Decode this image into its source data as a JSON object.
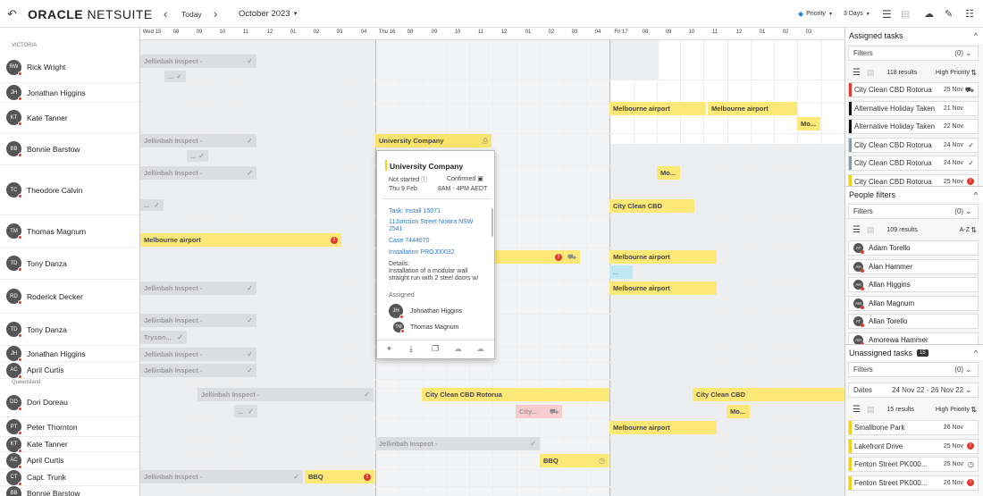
{
  "topbar": {
    "back_icon": "back-arrow-icon",
    "logo_oracle": "ORACLE",
    "logo_netsuite": "NETSUITE",
    "prev_label": "‹",
    "today_label": "Today",
    "next_label": "›",
    "month_label": "October 2023",
    "priority_label": "Priority",
    "days_label": "3 Days"
  },
  "sidebar": {
    "groups": [
      {
        "name": "VICTORIA"
      },
      {
        "name": "Queensland"
      }
    ],
    "resources": [
      {
        "initials": "RW",
        "name": "Rick Wright"
      },
      {
        "initials": "JH",
        "name": "Jonathan Higgins"
      },
      {
        "initials": "KT",
        "name": "Kate Tanner"
      },
      {
        "initials": "BB",
        "name": "Bonnie Barstow"
      },
      {
        "initials": "TC",
        "name": "Theodore Calvin"
      },
      {
        "initials": "TM",
        "name": "Thomas Magnum"
      },
      {
        "initials": "TD",
        "name": "Tony Danza"
      },
      {
        "initials": "RD",
        "name": "Roderick Decker"
      },
      {
        "initials": "TD",
        "name": "Tony Danza"
      },
      {
        "initials": "JH",
        "name": "Jonathan Higgins"
      },
      {
        "initials": "AC",
        "name": "April Curtis"
      },
      {
        "initials": "DD",
        "name": "Dori Doreau"
      },
      {
        "initials": "PT",
        "name": "Peter Thornton"
      },
      {
        "initials": "KT",
        "name": "Kate Tanner"
      },
      {
        "initials": "AC",
        "name": "April Curtis"
      },
      {
        "initials": "CT",
        "name": "Capt. Trunk"
      },
      {
        "initials": "BB",
        "name": "Bonnie Barstow"
      }
    ]
  },
  "timeline": {
    "days": [
      {
        "label": "Wed 15",
        "ticks": [
          "08",
          "09",
          "10",
          "11",
          "12",
          "01",
          "02",
          "03",
          "04"
        ]
      },
      {
        "label": "Thu 16",
        "ticks": [
          "08",
          "09",
          "10",
          "11",
          "12",
          "01",
          "02",
          "03",
          "04"
        ]
      },
      {
        "label": "Fri 17",
        "ticks": [
          "08",
          "09",
          "10",
          "11",
          "12",
          "01",
          "02",
          "03"
        ]
      }
    ],
    "tasks": {
      "t1": "Jellinbah Inspect -",
      "t2": "...",
      "t3": "Melbourne airport",
      "t4": "Melbourne airport",
      "t5": "Mo...",
      "t6": "Jellinbah Inspect -",
      "t7": "University Company",
      "t8": "...",
      "t9": "Jellinbah Inspect -",
      "t10": "Mo...",
      "t11": "...",
      "t12": "City Clean CBD",
      "t13": "Melbourne airport",
      "t14": "Melbourne airport",
      "t15": "...",
      "t16": "Jellinbah Inspect -",
      "t17": "Melbourne airport",
      "t18": "Jellinbah Inspect -",
      "t19": "Tryson...",
      "t20": "Jellinbah Inspect -",
      "t21": "Jellinbah Inspect -",
      "t22": "Jellinbah Inspect -",
      "t23": "City Clean CBD Rotorua",
      "t24": "City Clean CBD",
      "t25": "...",
      "t26": "City...",
      "t27": "Mo...",
      "t28": "Melbourne airport",
      "t29": "Jellinbah Inspect -",
      "t30": "BBQ",
      "t31": "Jellinbah Inspect -",
      "t32": "BBQ"
    }
  },
  "popup": {
    "title": "University Company",
    "status": "Not started",
    "confirmed": "Confirmed",
    "date": "Thu 9 Feb",
    "time": "8AM - 4PM AEDT",
    "task_link": "Task: Install 15071",
    "address_link": "11Junction Street Nowra NSW 2541",
    "case_link": "Case 7444670",
    "installation_link": "Installation PROJ00032",
    "details_label": "Details:",
    "details_text": "Installation of a modular wall straight run with 2 steel doors w/",
    "assigned_label": "Assigned",
    "assignees": [
      {
        "initials": "JH",
        "name": "Johnathan Higgins"
      },
      {
        "initials": "TM",
        "name": "Thomas Magnum"
      }
    ]
  },
  "assigned_panel": {
    "title": "Assigned tasks",
    "filters_label": "Filters",
    "filters_value": "(0)",
    "results": "118 results",
    "sort": "High Priority",
    "items": [
      {
        "name": "City Clean CBD Rotorua",
        "date": "25 Nov",
        "color": "#e03a2f",
        "icon": "truck-icon",
        "glyph": "⛟"
      },
      {
        "name": "Alternative Holiday Taken",
        "date": "21 Nov",
        "color": "#111111",
        "icon": "",
        "glyph": ""
      },
      {
        "name": "Alternative Holiday Taken",
        "date": "22 Nov",
        "color": "#111111",
        "icon": "",
        "glyph": ""
      },
      {
        "name": "City Clean CBD Rotorua",
        "date": "24 Nov",
        "color": "#8a9aa0",
        "icon": "check-icon",
        "glyph": "✓"
      },
      {
        "name": "City Clean CBD Rotorua",
        "date": "24 Nov",
        "color": "#8a9aa0",
        "icon": "check-icon",
        "glyph": "✓"
      },
      {
        "name": "City Clean CBD Rotorua",
        "date": "25 Nov",
        "color": "#f2d31b",
        "icon": "alert-icon",
        "glyph": "!"
      }
    ]
  },
  "people_panel": {
    "title": "People filters",
    "filters_label": "Filters",
    "filters_value": "(0)",
    "results": "109 results",
    "sort": "A-Z",
    "people": [
      {
        "initials": "AT",
        "name": "Adam Torello"
      },
      {
        "initials": "AH",
        "name": "Alan Hammer"
      },
      {
        "initials": "AH",
        "name": "Allan Higgins"
      },
      {
        "initials": "AM",
        "name": "Allan Magnum"
      },
      {
        "initials": "AT",
        "name": "Allan Torello"
      },
      {
        "initials": "AH",
        "name": "Amorewa Hammer"
      }
    ]
  },
  "unassigned_panel": {
    "title": "Unassigned tasks",
    "count": "15",
    "filters_label": "Filters",
    "filters_value": "(0)",
    "dates_label": "Dates",
    "dates_value": "24 Nov 22 - 26 Nov 22",
    "results": "15 results",
    "sort": "High Priority",
    "items": [
      {
        "name": "Smallbone Park",
        "date": "26 Nov",
        "color": "#f2d31b",
        "icon": "",
        "glyph": ""
      },
      {
        "name": "Lakefront Drive",
        "date": "25 Nov",
        "color": "#f2d31b",
        "icon": "alert-icon",
        "glyph": "!"
      },
      {
        "name": "Fenton Street PK000...",
        "date": "25 Nov",
        "color": "#f2d31b",
        "icon": "clock-icon",
        "glyph": "◷"
      },
      {
        "name": "Fenton Street PK000...",
        "date": "26 Nov",
        "color": "#f2d31b",
        "icon": "alert-icon",
        "glyph": "!"
      }
    ]
  }
}
